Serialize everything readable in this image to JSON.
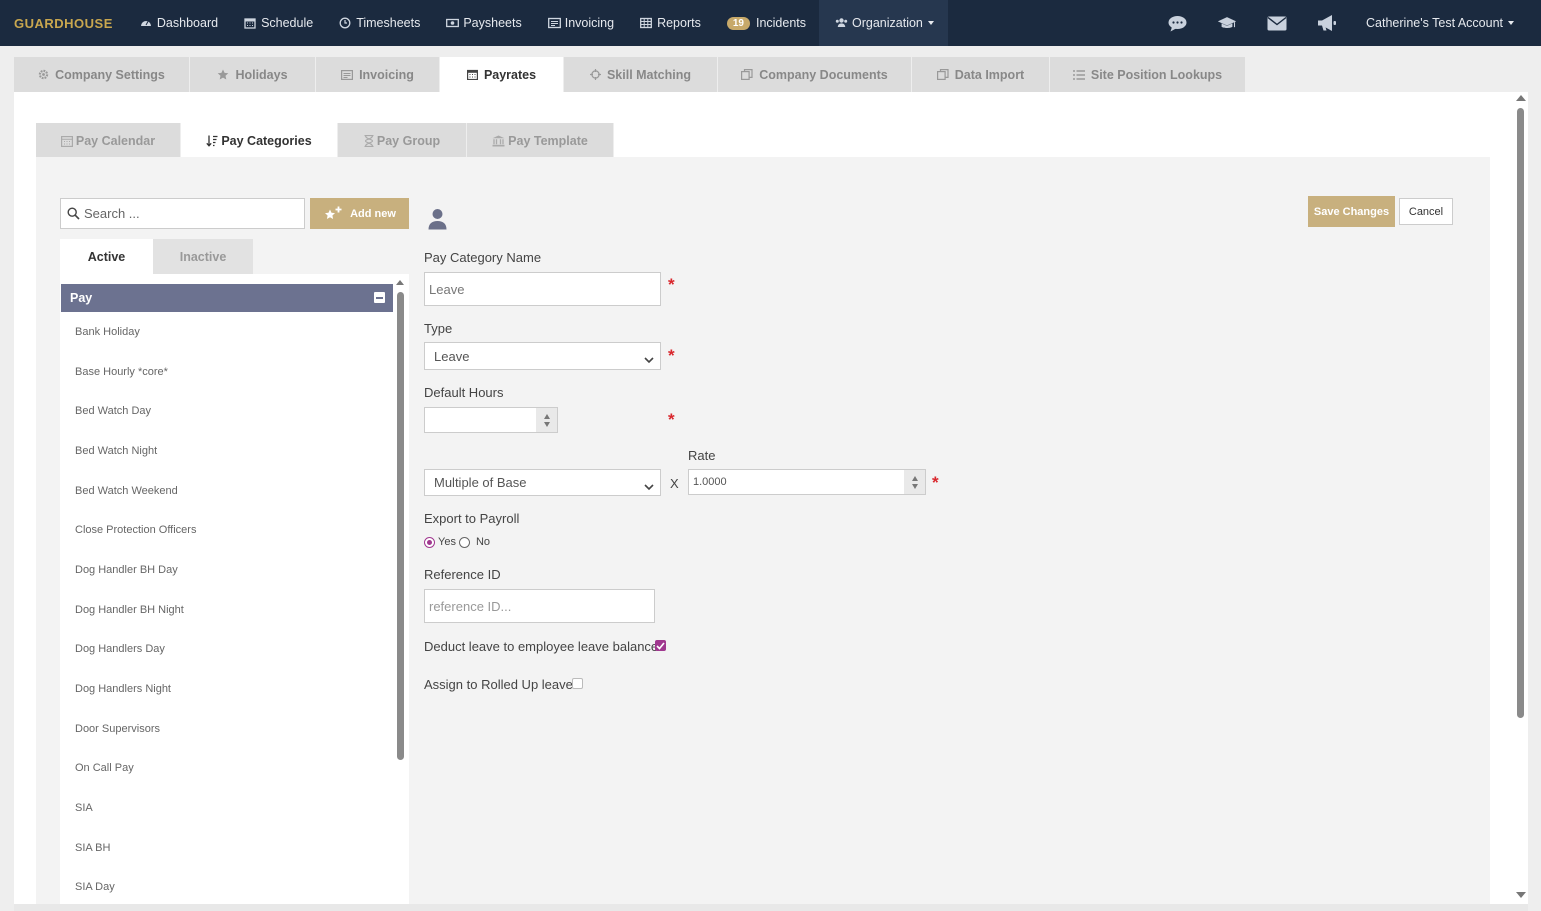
{
  "nav": {
    "brand": "GUARDHOUSE",
    "items": [
      {
        "label": "Dashboard",
        "icon": "dashboard-icon"
      },
      {
        "label": "Schedule",
        "icon": "calendar-icon"
      },
      {
        "label": "Timesheets",
        "icon": "clock-icon"
      },
      {
        "label": "Paysheets",
        "icon": "money-icon"
      },
      {
        "label": "Invoicing",
        "icon": "invoice-icon"
      },
      {
        "label": "Reports",
        "icon": "table-icon"
      }
    ],
    "incidents": {
      "badge": "19",
      "label": "Incidents"
    },
    "organization": "Organization",
    "account": "Catherine's Test Account"
  },
  "primary_tabs": [
    {
      "label": "Company Settings",
      "icon": "gear-icon"
    },
    {
      "label": "Holidays",
      "icon": "star-icon"
    },
    {
      "label": "Invoicing",
      "icon": "invoice-icon"
    },
    {
      "label": "Payrates",
      "icon": "calendar-icon"
    },
    {
      "label": "Skill Matching",
      "icon": "crosshair-icon"
    },
    {
      "label": "Company Documents",
      "icon": "documents-icon"
    },
    {
      "label": "Data Import",
      "icon": "documents-icon"
    },
    {
      "label": "Site Position Lookups",
      "icon": "list-icon"
    }
  ],
  "secondary_tabs": [
    {
      "label": "Pay Calendar"
    },
    {
      "label": "Pay Categories"
    },
    {
      "label": "Pay Group"
    },
    {
      "label": "Pay Template"
    }
  ],
  "sidebar": {
    "search_placeholder": "Search ...",
    "add_new": "Add new",
    "tabs": [
      "Active",
      "Inactive"
    ],
    "group": "Pay",
    "items": [
      "Bank Holiday",
      "Base Hourly *core*",
      "Bed Watch Day",
      "Bed Watch Night",
      "Bed Watch Weekend",
      "Close Protection Officers",
      "Dog Handler BH Day",
      "Dog Handler BH Night",
      "Dog Handlers Day",
      "Dog Handlers Night",
      "Door Supervisors",
      "On Call Pay",
      "SIA",
      "SIA BH",
      "SIA Day"
    ]
  },
  "form": {
    "save": "Save Changes",
    "cancel": "Cancel",
    "name_label": "Pay Category Name",
    "name_value": "Leave",
    "type_label": "Type",
    "type_value": "Leave",
    "hours_label": "Default Hours",
    "hours_value": "",
    "rate_mode": "Multiple of Base",
    "multiply": "X",
    "rate_label": "Rate",
    "rate_value": "1.0000",
    "export_label": "Export to Payroll",
    "yes": "Yes",
    "no": "No",
    "export_selected": "Yes",
    "ref_label": "Reference ID",
    "ref_placeholder": "reference ID...",
    "deduct_label": "Deduct leave to employee leave balance",
    "deduct_checked": true,
    "rolled_label": "Assign to Rolled Up leave",
    "rolled_checked": false,
    "required_mark": "*"
  },
  "colors": {
    "nav_bg": "#1b2a3f",
    "brand": "#c9a74f",
    "gold_button": "#c8b07e",
    "group_header": "#6c7290",
    "required": "#d9262c",
    "check_accent": "#a0388f"
  }
}
